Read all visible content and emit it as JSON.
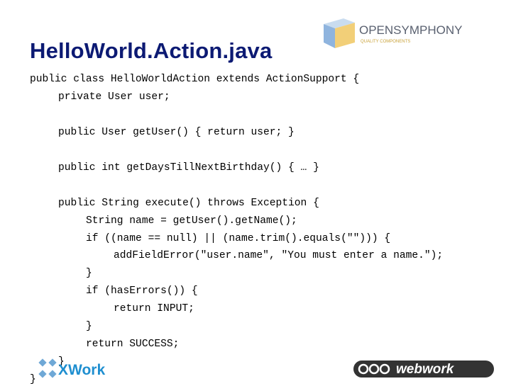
{
  "slide": {
    "title": "HelloWorld.Action.java"
  },
  "code_lines": [
    "public class HelloWorldAction extends ActionSupport {",
    "private User user;",
    "public User getUser() { return user; }",
    "public int getDaysTillNextBirthday() { … }",
    "public String execute() throws Exception {",
    "String name = getUser().getName();",
    "if ((name == null) || (name.trim().equals(\"\"))) {",
    "addFieldError(\"user.name\", \"You must enter a name.\");",
    "}",
    "if (hasErrors()) {",
    "return INPUT;",
    "}",
    "return SUCCESS;",
    "}",
    "}"
  ],
  "logos": {
    "opensymphony": {
      "name": "OPENSYMPHONY",
      "tagline": "QUALITY COMPONENTS"
    },
    "xwork": {
      "name": "XWork"
    },
    "webwork": {
      "name": "webwork"
    }
  },
  "colors": {
    "title": "#0c1a73",
    "xwork_blue": "#1f8fd0",
    "webwork_dark": "#333333"
  }
}
